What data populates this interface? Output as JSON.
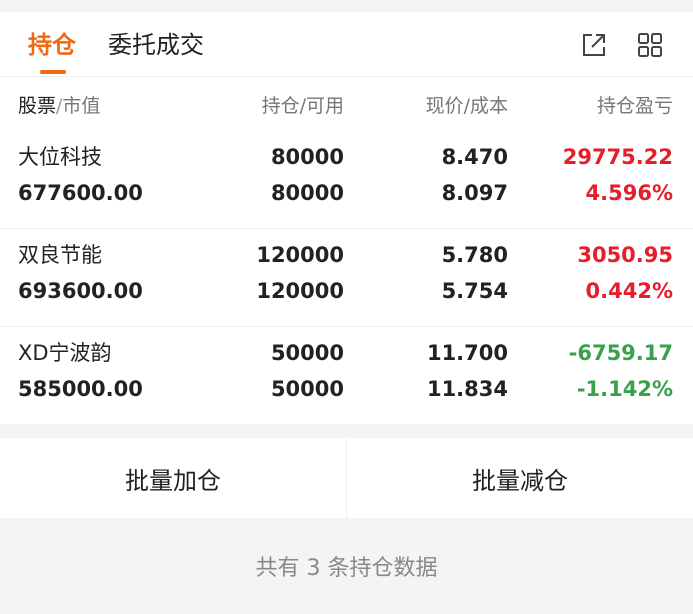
{
  "tabs": [
    {
      "label": "持仓",
      "active": true
    },
    {
      "label": "委托成交",
      "active": false
    }
  ],
  "icons": {
    "export": "external-link-icon",
    "grid": "grid-icon"
  },
  "colors": {
    "accent": "#ef6a14",
    "up": "#e41e2b",
    "down": "#3aa04a"
  },
  "header": {
    "name": "股票",
    "market_value": "市值",
    "position": "持仓/可用",
    "price": "现价/成本",
    "pnl": "持仓盈亏"
  },
  "holdings": [
    {
      "name": "大位科技",
      "market_value": "677600.00",
      "position": "80000",
      "available": "80000",
      "price": "8.470",
      "cost": "8.097",
      "pnl": "29775.22",
      "pnl_pct": "4.596%",
      "trend": "up"
    },
    {
      "name": "双良节能",
      "market_value": "693600.00",
      "position": "120000",
      "available": "120000",
      "price": "5.780",
      "cost": "5.754",
      "pnl": "3050.95",
      "pnl_pct": "0.442%",
      "trend": "up"
    },
    {
      "name": "XD宁波韵",
      "market_value": "585000.00",
      "position": "50000",
      "available": "50000",
      "price": "11.700",
      "cost": "11.834",
      "pnl": "-6759.17",
      "pnl_pct": "-1.142%",
      "trend": "down"
    }
  ],
  "actions": {
    "batch_add": "批量加仓",
    "batch_reduce": "批量减仓"
  },
  "footer": "共有 3 条持仓数据"
}
